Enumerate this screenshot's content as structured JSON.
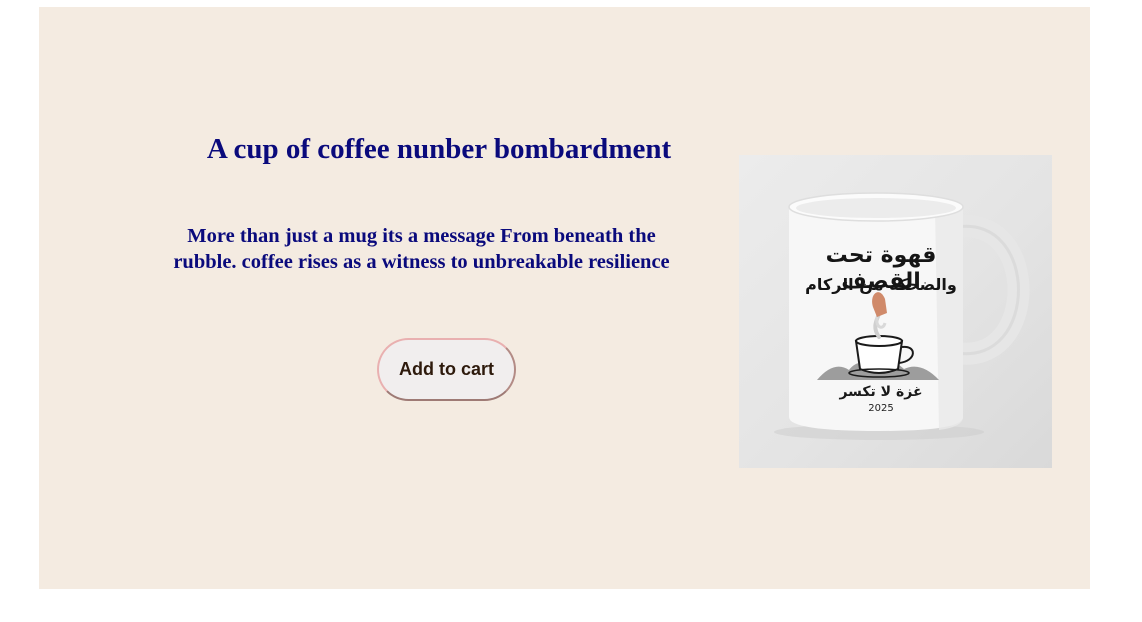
{
  "product": {
    "title": "A cup of coffee nunber bombardment",
    "description": "More than just a mug its a message From beneath the rubble. coffee rises as a witness to unbreakable resilience",
    "add_to_cart_label": "Add to cart",
    "image": {
      "print_line1": "قهوة تحت القصف",
      "print_line2": "والضحكة من الركام",
      "print_line3": "غزة لا تكسر",
      "print_year": "2025"
    }
  },
  "colors": {
    "card_background": "#f4ebe1",
    "heading_text": "#0a0a7c",
    "button_border": "#e9b0b0",
    "button_text": "#2e1a0c"
  }
}
